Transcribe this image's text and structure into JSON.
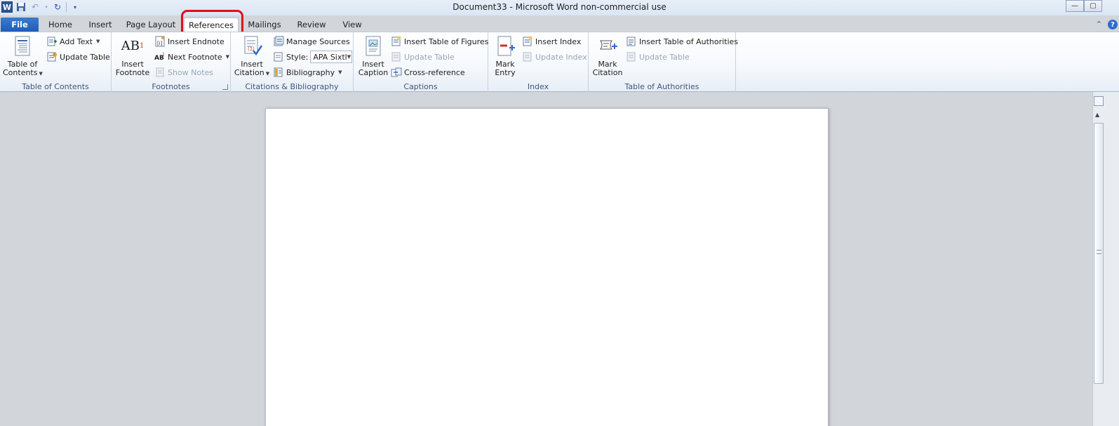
{
  "titlebar": {
    "app_letter": "W",
    "title": "Document33  -  Microsoft Word non-commercial use",
    "window_buttons": {
      "minimize": "—",
      "restore": "▢",
      "close": "✕"
    }
  },
  "tabs": {
    "file": "File",
    "home": "Home",
    "insert": "Insert",
    "page_layout": "Page Layout",
    "references": "References",
    "mailings": "Mailings",
    "review": "Review",
    "view": "View",
    "help": "?",
    "collapse": "⌃"
  },
  "groups": {
    "toc": {
      "label": "Table of Contents",
      "table_of_contents_line1": "Table of",
      "table_of_contents_line2": "Contents",
      "add_text": "Add Text",
      "update_table": "Update Table"
    },
    "footnotes": {
      "label": "Footnotes",
      "insert_footnote_line1": "Insert",
      "insert_footnote_line2": "Footnote",
      "ab_glyph": "AB",
      "superscript": "1",
      "insert_endnote": "Insert Endnote",
      "next_footnote": "Next Footnote",
      "show_notes": "Show Notes"
    },
    "citations": {
      "label": "Citations & Bibliography",
      "insert_citation_line1": "Insert",
      "insert_citation_line2": "Citation",
      "manage_sources": "Manage Sources",
      "style_label": "Style:",
      "style_value": "APA Sixtl",
      "bibliography": "Bibliography"
    },
    "captions": {
      "label": "Captions",
      "insert_caption_line1": "Insert",
      "insert_caption_line2": "Caption",
      "insert_table_of_figures": "Insert Table of Figures",
      "update_table": "Update Table",
      "cross_reference": "Cross-reference"
    },
    "index": {
      "label": "Index",
      "mark_entry_line1": "Mark",
      "mark_entry_line2": "Entry",
      "insert_index": "Insert Index",
      "update_index": "Update Index"
    },
    "authorities": {
      "label": "Table of Authorities",
      "mark_citation_line1": "Mark",
      "mark_citation_line2": "Citation",
      "insert_table_of_authorities": "Insert Table of Authorities",
      "update_table": "Update Table"
    }
  },
  "colors": {
    "file_tab": "#1e5bb5",
    "highlight_ring": "#e20c1d",
    "workspace": "#d2d5da",
    "page": "#ffffff"
  }
}
